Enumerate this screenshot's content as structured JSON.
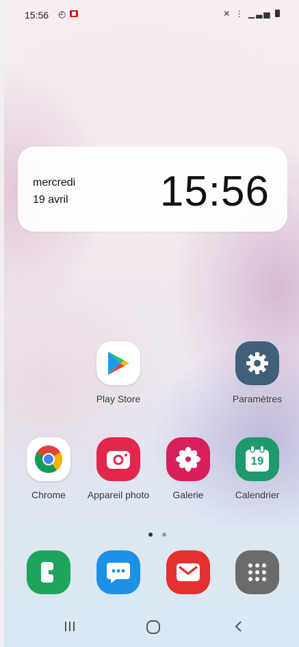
{
  "status_bar": {
    "time": "15:56",
    "right_icons": "mute-icon, wifi-icon, signal-icon, battery-icon"
  },
  "clock_widget": {
    "day": "mercredi",
    "date": "19 avril",
    "time": "15:56"
  },
  "apps": {
    "play_store": "Play Store",
    "parametres": "Paramètres",
    "chrome": "Chrome",
    "appareil_photo": "Appareil photo",
    "galerie": "Galerie",
    "calendrier": "Calendrier",
    "calendrier_day": "19"
  },
  "dock": [
    "phone-icon",
    "messages-icon",
    "email-icon",
    "apps-drawer-icon"
  ],
  "colors": {
    "play_bg": "#ffffff",
    "settings_bg": "#3f5f7a",
    "chrome_bg": "#ffffff",
    "camera_bg": "#e3264c",
    "gallery_bg": "#d81f5a",
    "calendar_bg": "#1f9a6b",
    "phone_bg": "#1fa55b",
    "messages_bg": "#1e90e6",
    "email_bg": "#e53030",
    "drawer_bg": "#6b6b6b"
  },
  "navigation": [
    "recent-apps-icon",
    "home-icon",
    "back-icon"
  ]
}
